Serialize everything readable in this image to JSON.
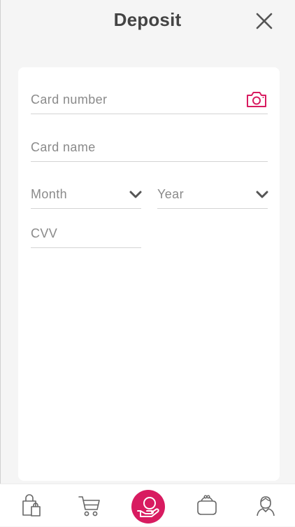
{
  "header": {
    "title": "Deposit"
  },
  "form": {
    "card_number_placeholder": "Card number",
    "card_name_placeholder": "Card name",
    "month_placeholder": "Month",
    "year_placeholder": "Year",
    "cvv_placeholder": "CVV"
  },
  "icons": {
    "close": "close-icon",
    "camera": "camera-icon",
    "chevron": "chevron-down-icon",
    "nav_shop": "shopping-bag-icon",
    "nav_cart": "cart-icon",
    "nav_deposit": "deposit-hand-coin-icon",
    "nav_wallet": "wallet-purse-icon",
    "nav_profile": "profile-avatar-icon"
  },
  "colors": {
    "accent": "#d81b60",
    "title": "#444444",
    "placeholder": "#8a8a8a",
    "background": "#f5f5f5",
    "card": "#ffffff"
  }
}
